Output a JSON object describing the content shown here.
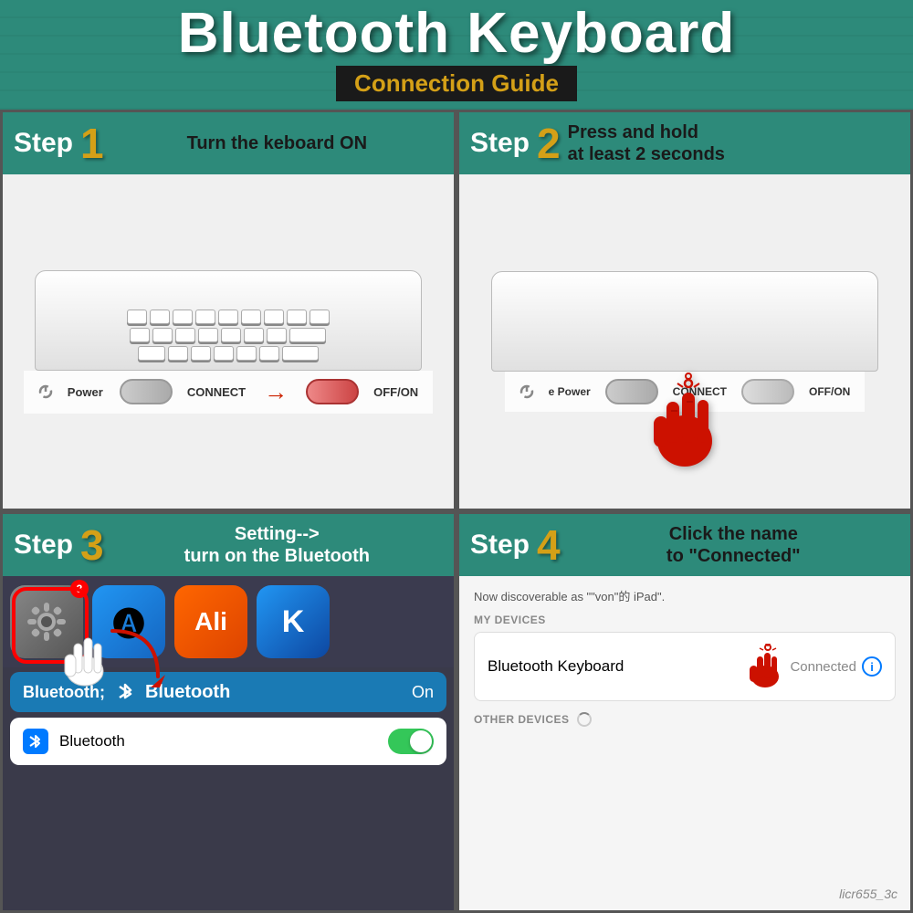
{
  "header": {
    "title": "Bluetooth Keyboard",
    "subtitle": "Connection Guide",
    "bg_color": "#2d8a7a"
  },
  "step1": {
    "step_label": "Step",
    "step_number": "1",
    "description": "Turn the keboard ON",
    "switch_labels": [
      "Power",
      "CONNECT",
      "OFF/ON"
    ],
    "arrow": "→"
  },
  "step2": {
    "step_label": "Step",
    "step_number": "2",
    "description_line1": "Press and hold",
    "description_line2": "at least 2 seconds",
    "switch_labels": [
      "e Power",
      "CONNECT",
      "OFF/ON"
    ]
  },
  "step3": {
    "step_label": "Step",
    "step_number": "3",
    "description_line1": "Setting-->",
    "description_line2": "turn on the Bluetooth",
    "badge": "3",
    "bluetooth_label": "Bluetooth",
    "bluetooth_status": "On",
    "settings_item": "Bluetooth",
    "toggle_state": "on"
  },
  "step4": {
    "step_label": "Step",
    "step_number": "4",
    "description_line1": "Click the name",
    "description_line2": "to \"Connected\"",
    "discoverable_text": "Now discoverable as \"\"von\"的 iPad\".",
    "my_devices_label": "MY DEVICES",
    "device_name": "Bluetooth  Keyboard",
    "connected_text": "Connected",
    "other_devices_label": "OTHER DEVICES",
    "watermark": "licr655_3c"
  }
}
